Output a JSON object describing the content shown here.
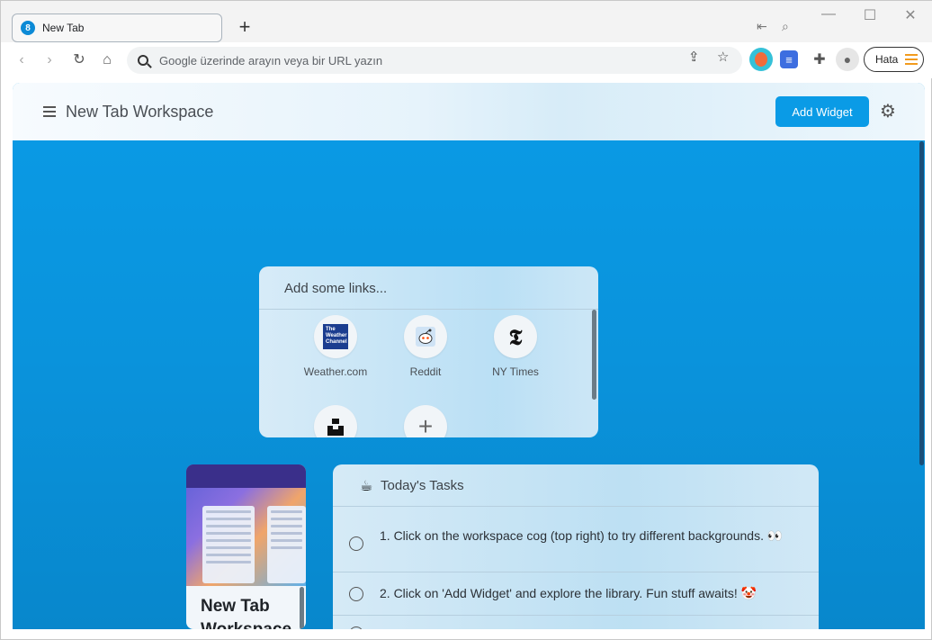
{
  "browser": {
    "tab": {
      "title": "New Tab"
    },
    "omnibox": {
      "placeholder": "Google üzerinde arayın veya bir URL yazın"
    },
    "profile_button": {
      "label": "Hata"
    }
  },
  "workspace": {
    "title": "New Tab Workspace",
    "add_widget_label": "Add Widget"
  },
  "links_widget": {
    "title": "Add some links...",
    "links": [
      {
        "label": "Weather.com",
        "icon": "weather-channel-icon"
      },
      {
        "label": "Reddit",
        "icon": "reddit-icon"
      },
      {
        "label": "NY Times",
        "icon": "nytimes-icon"
      }
    ],
    "weather_logo_text": "The Weather Channel"
  },
  "preview_card": {
    "title": "New Tab Workspace"
  },
  "tasks_widget": {
    "title": "Today's Tasks",
    "tasks": [
      {
        "text": "1. Click on the workspace cog (top right) to try different backgrounds. 👀",
        "done": false
      },
      {
        "text": "2. Click on 'Add Widget' and explore the library. Fun stuff awaits! 🤡",
        "done": false
      }
    ]
  },
  "colors": {
    "accent": "#0a9be6",
    "page_background": "#0a93dc"
  }
}
